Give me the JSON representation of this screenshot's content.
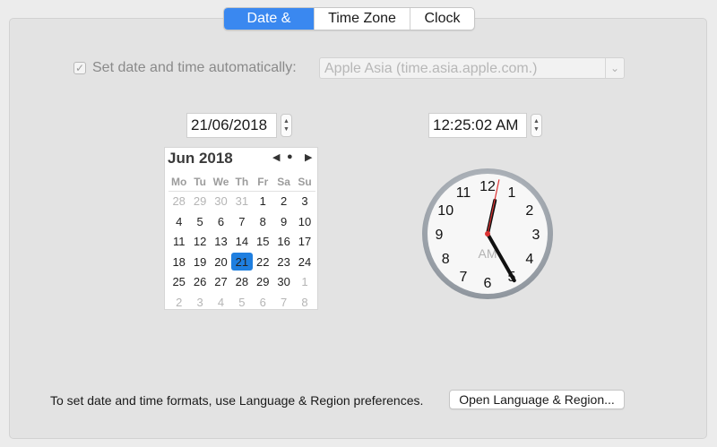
{
  "tabs": [
    {
      "label": "Date & Time"
    },
    {
      "label": "Time Zone"
    },
    {
      "label": "Clock"
    }
  ],
  "auto": {
    "checked_glyph": "✓",
    "label": "Set date and time automatically:",
    "server": "Apple Asia (time.asia.apple.com.)",
    "dropdown_glyph": "⌄"
  },
  "date": {
    "value": "21/06/2018"
  },
  "time": {
    "value": "12:25:02 AM"
  },
  "calendar": {
    "title": "Jun 2018",
    "nav": {
      "prev": "◀",
      "today": "●",
      "next": "▶"
    },
    "weekdays": [
      "Mo",
      "Tu",
      "We",
      "Th",
      "Fr",
      "Sa",
      "Su"
    ],
    "weeks": [
      [
        "28",
        "29",
        "30",
        "31",
        "1",
        "2",
        "3"
      ],
      [
        "4",
        "5",
        "6",
        "7",
        "8",
        "9",
        "10"
      ],
      [
        "11",
        "12",
        "13",
        "14",
        "15",
        "16",
        "17"
      ],
      [
        "18",
        "19",
        "20",
        "21",
        "22",
        "23",
        "24"
      ],
      [
        "25",
        "26",
        "27",
        "28",
        "29",
        "30",
        "1"
      ],
      [
        "2",
        "3",
        "4",
        "5",
        "6",
        "7",
        "8"
      ]
    ],
    "selected": "21"
  },
  "clock": {
    "numbers": [
      "12",
      "1",
      "2",
      "3",
      "4",
      "5",
      "6",
      "7",
      "8",
      "9",
      "10",
      "11"
    ],
    "ampm": "AM",
    "hour": 12,
    "minute": 25,
    "second": 2
  },
  "footer": {
    "text": "To set date and time formats, use Language & Region preferences.",
    "button": "Open Language & Region..."
  }
}
